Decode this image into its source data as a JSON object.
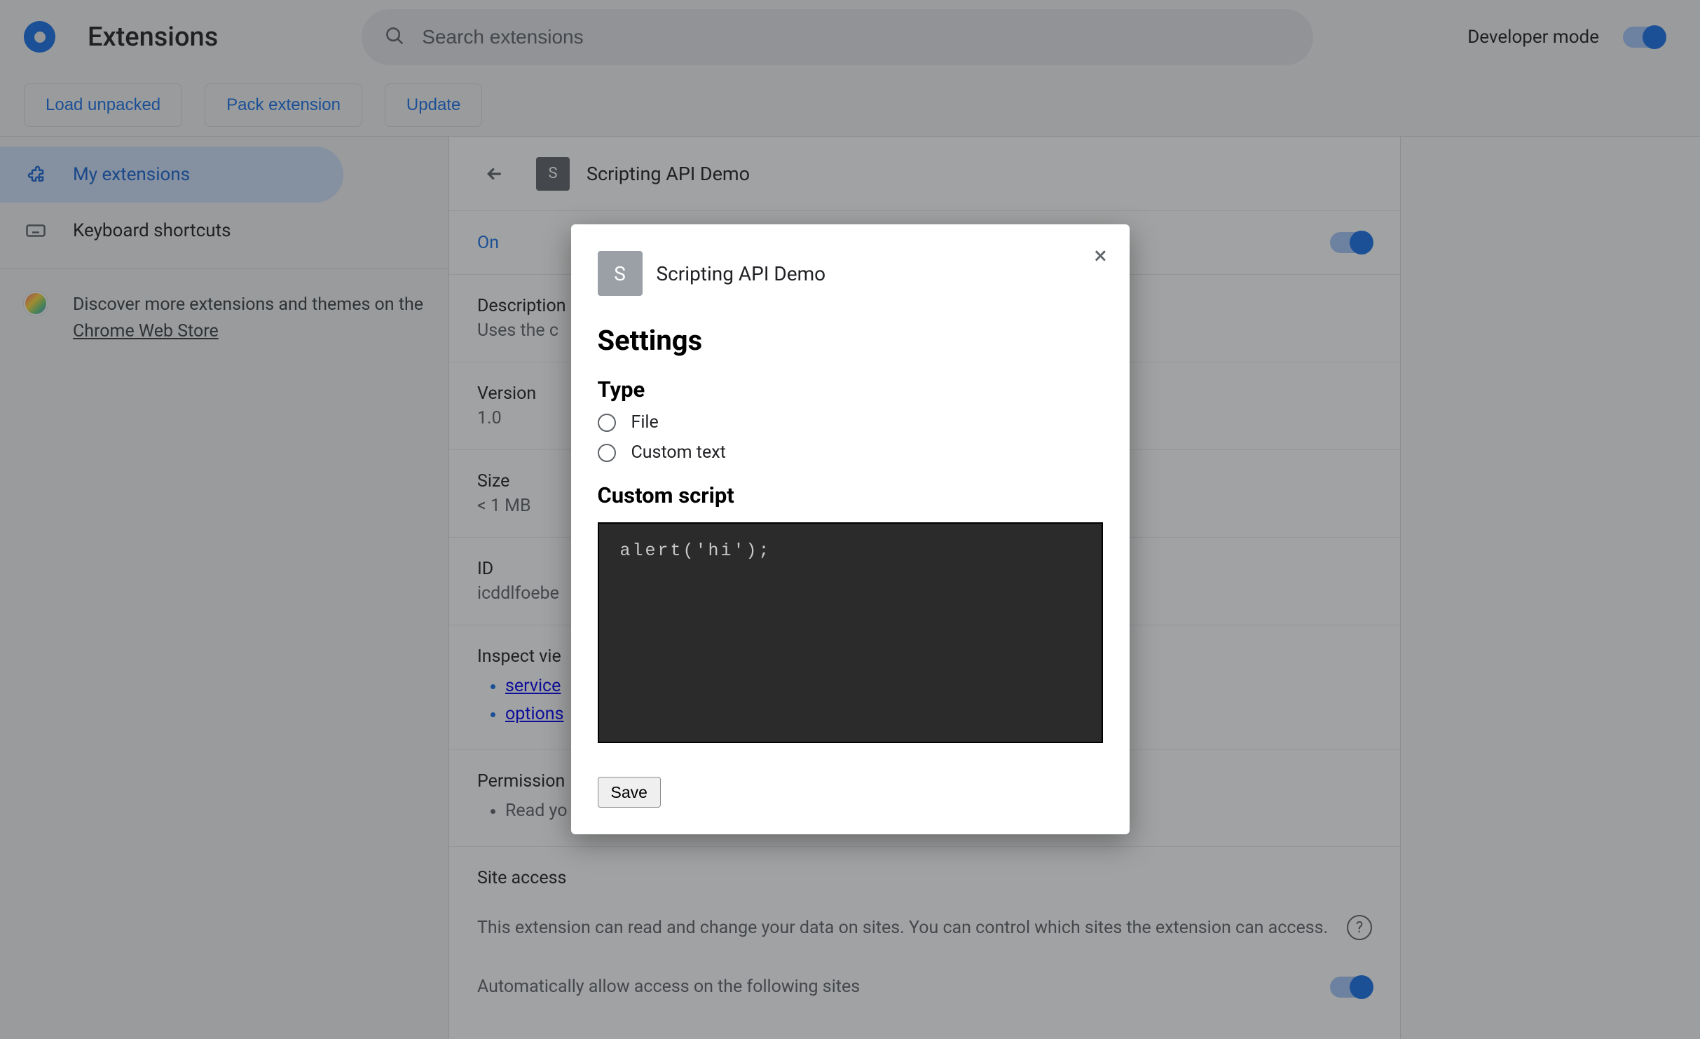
{
  "header": {
    "app_title": "Extensions",
    "search_placeholder": "Search extensions",
    "dev_mode_label": "Developer mode"
  },
  "toolbar": {
    "load_unpacked": "Load unpacked",
    "pack_extension": "Pack extension",
    "update": "Update"
  },
  "sidebar": {
    "my_extensions": "My extensions",
    "keyboard_shortcuts": "Keyboard shortcuts",
    "discover_text_prefix": "Discover more extensions and themes on the ",
    "discover_link": "Chrome Web Store"
  },
  "detail": {
    "title": "Scripting API Demo",
    "on_label": "On",
    "description_label": "Description",
    "description_value": "Uses the c",
    "version_label": "Version",
    "version_value": "1.0",
    "size_label": "Size",
    "size_value": "< 1 MB",
    "id_label": "ID",
    "id_value": "icddlfoebe",
    "inspect_label": "Inspect vie",
    "inspect_items": [
      "service",
      "options"
    ],
    "permissions_label": "Permission",
    "permissions_items": [
      "Read yo"
    ],
    "site_access_label": "Site access",
    "site_access_desc": "This extension can read and change your data on sites. You can control which sites the extension can access.",
    "auto_allow_label": "Automatically allow access on the following sites"
  },
  "modal": {
    "ext_initial": "S",
    "ext_name": "Scripting API Demo",
    "settings_heading": "Settings",
    "type_heading": "Type",
    "type_options": [
      "File",
      "Custom text"
    ],
    "custom_script_heading": "Custom script",
    "script_value": "alert('hi');",
    "save_label": "Save"
  }
}
